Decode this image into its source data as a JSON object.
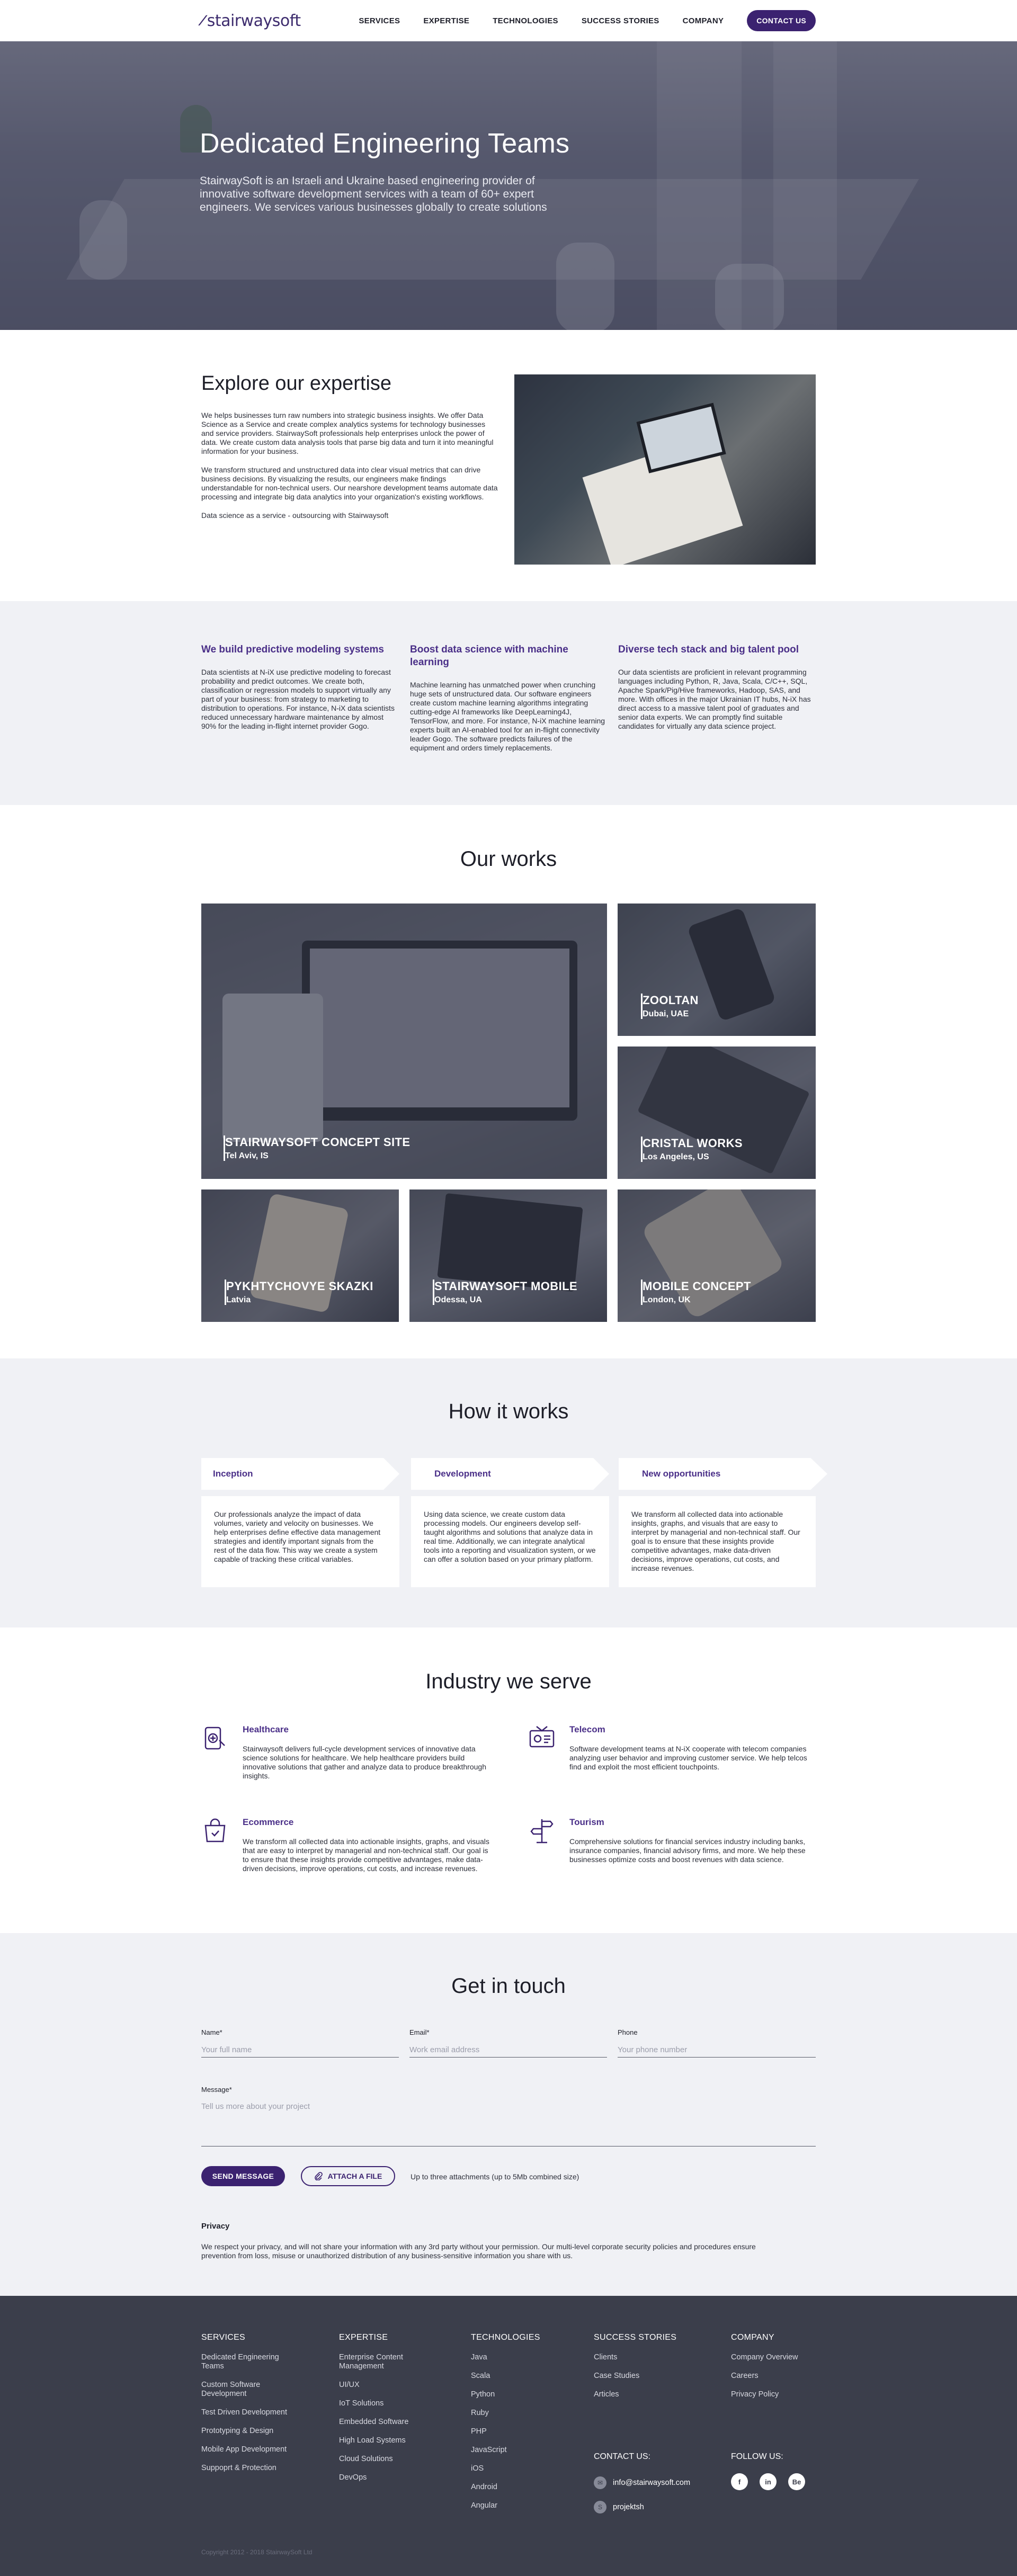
{
  "header": {
    "logo_mark": "∕",
    "logo_text": "stairwaysoft",
    "nav": [
      "SERVICES",
      "EXPERTISE",
      "TECHNOLOGIES",
      "SUCCESS STORIES",
      "COMPANY"
    ],
    "cta": "CONTACT US"
  },
  "hero": {
    "title": "Dedicated Engineering Teams",
    "text": "StairwaySoft is an Israeli and Ukraine based engineering provider of innovative software development services with a team of 60+ expert engineers. We services various businesses globally to create solutions"
  },
  "expertise": {
    "title": "Explore our expertise",
    "p1": "We helps businesses turn raw numbers into strategic business insights. We offer Data Science as a Service and create complex analytics systems for technology businesses and service providers. StairwaySoft professionals help enterprises unlock the power of data. We create custom data analysis tools that parse big data and turn it into meaningful information for your business.",
    "p2": "We transform structured and unstructured data into clear visual metrics that can drive business decisions. By visualizing the results, our engineers make findings understandable for non-technical users. Our nearshore development teams automate data processing and integrate big data analytics into your organization's existing workflows.",
    "p3": "Data science as a service - outsourcing with Stairwaysoft"
  },
  "features": [
    {
      "title": "We build predictive modeling systems",
      "text": "Data scientists at N-iX use predictive modeling to forecast probability and predict outcomes. We create both, classification or regression models to support virtually any part of your business: from strategy to marketing to distribution to operations. For instance, N-iX data scientists reduced unnecessary hardware maintenance by almost 90% for the leading in-flight internet provider Gogo."
    },
    {
      "title": "Boost data science with machine learning",
      "text": "Machine learning has unmatched power when crunching huge sets of unstructured data. Our software engineers create custom machine learning algorithms integrating cutting-edge AI frameworks like DeepLearning4J, TensorFlow, and more. For instance, N-iX machine learning experts built an AI-enabled tool for an in-flight connectivity leader Gogo. The software predicts failures of the equipment and orders timely replacements."
    },
    {
      "title": "Diverse tech stack and big talent pool",
      "text": "Our data scientists are proficient in relevant programming languages including Python, R, Java, Scala, C/C++, SQL, Apache Spark/Pig/Hive frameworks, Hadoop, SAS, and more. With offices in the major Ukrainian IT hubs, N-iX has direct access to a massive talent pool of graduates and senior data experts. We can promptly find suitable candidates for virtually any data science project."
    }
  ],
  "works": {
    "title": "Our works",
    "items": [
      {
        "title": "STAIRWAYSOFT CONCEPT SITE",
        "location": "Tel Aviv, IS"
      },
      {
        "title": "ZOOLTAN",
        "location": "Dubai, UAE"
      },
      {
        "title": "CRISTAL WORKS",
        "location": "Los Angeles, US"
      },
      {
        "title": "PYKHTYCHOVYE SKAZKI",
        "location": "Latvia"
      },
      {
        "title": "STAIRWAYSOFT MOBILE",
        "location": "Odessa, UA"
      },
      {
        "title": "MOBILE CONCEPT",
        "location": "London, UK"
      }
    ]
  },
  "how": {
    "title": "How it works",
    "steps": [
      {
        "label": "Inception",
        "text": "Our professionals analyze the impact of data volumes, variety and velocity on businesses. We help enterprises define effective data management strategies and identify important signals from the rest of the data flow. This way we create a system capable of tracking these critical variables."
      },
      {
        "label": "Development",
        "text": "Using data science, we create custom data processing models. Our engineers develop self-taught algorithms and solutions that analyze data in real time. Additionally, we can integrate analytical tools into a reporting and visualization system, or we can offer a solution based on your primary platform."
      },
      {
        "label": "New opportunities",
        "text": "We transform all collected data into actionable insights, graphs, and visuals that are easy to interpret by managerial and non-technical staff. Our goal is to ensure that these insights provide competitive advantages, make data-driven decisions, improve operations, cut costs, and increase revenues."
      }
    ]
  },
  "industry": {
    "title": "Industry we serve",
    "items": [
      {
        "name": "Healthcare",
        "icon": "healthcare-icon",
        "text": "Stairwaysoft delivers full-cycle development services of innovative data science solutions for healthcare. We help healthcare providers build innovative solutions that gather and analyze data to produce breakthrough insights."
      },
      {
        "name": "Telecom",
        "icon": "telecom-icon",
        "text": "Software development teams at N-iX cooperate with telecom companies analyzing user behavior and improving customer service. We help telcos find and exploit the most efficient touchpoints."
      },
      {
        "name": "Ecommerce",
        "icon": "ecommerce-icon",
        "text": "We transform all collected data into actionable insights, graphs, and visuals that are easy to interpret by managerial and non-technical staff. Our goal is to ensure that these insights provide competitive advantages, make data-driven decisions, improve operations, cut costs, and increase revenues."
      },
      {
        "name": "Tourism",
        "icon": "tourism-icon",
        "text": "Comprehensive solutions for financial services industry including banks, insurance companies, financial advisory firms, and more. We help these businesses optimize costs and boost revenues with data science."
      }
    ]
  },
  "contact": {
    "title": "Get in touch",
    "name_label": "Name*",
    "name_placeholder": "Your full name",
    "email_label": "Email*",
    "email_placeholder": "Work email address",
    "phone_label": "Phone",
    "phone_placeholder": "Your phone number",
    "message_label": "Message*",
    "message_placeholder": "Tell us more about your project",
    "send": "SEND MESSAGE",
    "attach": "ATTACH A FILE",
    "attach_note": "Up to three attachments (up to 5Mb combined size)",
    "privacy_title": "Privacy",
    "privacy_text": "We respect your privacy, and will not share your information with any 3rd party without your permission. Our multi-level corporate security policies and procedures ensure prevention from loss, misuse or unauthorized distribution of any business-sensitive information you share with us."
  },
  "footer": {
    "columns": [
      {
        "title": "SERVICES",
        "links": [
          "Dedicated Engineering Teams",
          "Custom Software Development",
          "Test Driven Development",
          "Prototyping & Design",
          "Mobile App Development",
          "Suppoprt & Protection"
        ]
      },
      {
        "title": "EXPERTISE",
        "links": [
          "Enterprise Content Management",
          "UI/UX",
          "IoT Solutions",
          "Embedded Software",
          "High Load Systems",
          "Cloud Solutions",
          "DevOps"
        ]
      },
      {
        "title": "TECHNOLOGIES",
        "links": [
          "Java",
          "Scala",
          "Python",
          "Ruby",
          "PHP",
          "JavaScript",
          "iOS",
          "Android",
          "Angular"
        ]
      },
      {
        "title": "SUCCESS STORIES",
        "links": [
          "Clients",
          "Case Studies",
          "Articles"
        ]
      },
      {
        "title": "COMPANY",
        "links": [
          "Company Overview",
          "Careers",
          "Privacy Policy"
        ]
      }
    ],
    "contact_title": "CONTACT US:",
    "email": "info@stairwaysoft.com",
    "skype": "projektsh",
    "follow_title": "FOLLOW US:",
    "social": [
      "f",
      "in",
      "Be"
    ],
    "copyright": "Copyright 2012 - 2018 StairwaySoft Ltd"
  }
}
